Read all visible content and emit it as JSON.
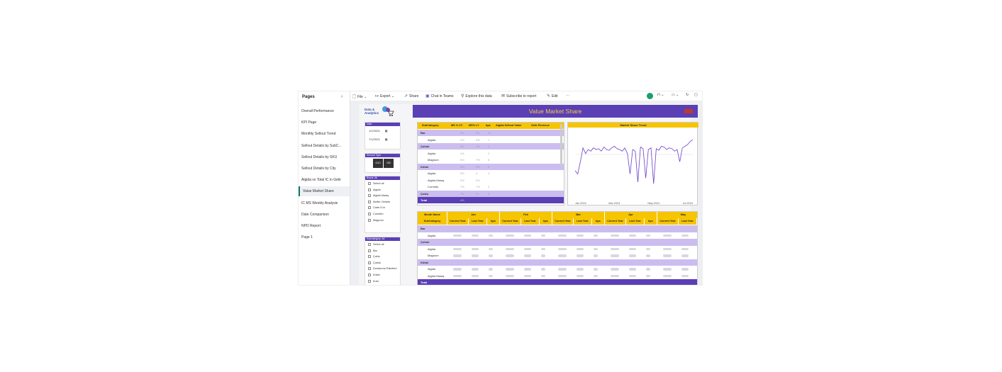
{
  "sidebar": {
    "title": "Pages",
    "collapse_icon": "chevron-left-icon",
    "items": [
      {
        "label": "Overall Performance"
      },
      {
        "label": "KPI Page"
      },
      {
        "label": "Monthly Sellout Trend"
      },
      {
        "label": "Sellout Details by SubC..."
      },
      {
        "label": "Sellout Details by SKU"
      },
      {
        "label": "Sellout Details by City"
      },
      {
        "label": "Algida vs Total IC in Getir"
      },
      {
        "label": "Value Market Share",
        "active": true
      },
      {
        "label": "IC MS Weekly Analysis"
      },
      {
        "label": "Date Comparison"
      },
      {
        "label": "NPD Report"
      },
      {
        "label": "Page 1"
      }
    ]
  },
  "toolbar": {
    "file": "File",
    "export": "Export",
    "share": "Share",
    "chat": "Chat in Teams",
    "explore": "Explore this data",
    "subscribe": "Subscribe to report",
    "edit": "Edit",
    "more": "···"
  },
  "report": {
    "title": "Value Market Share",
    "logo_text_1": "Data &",
    "logo_text_2": "Analytics",
    "accent": "#5b3fb5",
    "header_yellow": "#f6c500"
  },
  "date_slicer": {
    "header": "Date",
    "start": "1/1/2024",
    "end": "7/1/2024"
  },
  "service_slicer": {
    "header": "Service Type",
    "options": [
      "G10",
      "GB"
    ]
  },
  "brand_slicer": {
    "header": "Brand: All",
    "items": [
      "Select all",
      "Algida",
      "Algida Maraş",
      "Atelier Gelarto",
      "Carte D'or",
      "Cornetto",
      "Magnum"
    ]
  },
  "subcat_slicer": {
    "header": "Subcategory: All",
    "items": [
      "Select all",
      "Bar",
      "Çoklu",
      "Çubuk",
      "Dondurma Paketleri",
      "Külah",
      "Kutu"
    ]
  },
  "top_table": {
    "headers": [
      "SubCategory",
      "MS % CY",
      "MS% LY",
      "bps",
      "Algida Sellout Value",
      "Getir Revenue"
    ],
    "rows": [
      {
        "type": "cat",
        "name": "Bar",
        "c1": "3%",
        "c2": "8%",
        "c3": "11"
      },
      {
        "type": "sub",
        "name": "Algida",
        "c1": "3%",
        "c2": "5%",
        "c3": "1"
      },
      {
        "type": "cat",
        "name": "Çubuk",
        "c1": "8%",
        "c2": "1%",
        "c3": "1"
      },
      {
        "type": "sub",
        "name": "Algida",
        "c1": "4%",
        "c2": "",
        "c3": "2"
      },
      {
        "type": "sub",
        "name": "Magnum",
        "c1": "6%",
        "c2": "7%",
        "c3": "8"
      },
      {
        "type": "cat",
        "name": "Külah",
        "c1": "3%",
        "c2": "8%",
        "c3": "8"
      },
      {
        "type": "sub",
        "name": "Algida",
        "c1": "3%",
        "c2": "4",
        "c3": "4"
      },
      {
        "type": "sub",
        "name": "Algida Maraş",
        "c1": "0%",
        "c2": "5%",
        "c3": ""
      },
      {
        "type": "sub",
        "name": "Cornetto",
        "c1": "7%",
        "c2": "7%",
        "c3": "2"
      },
      {
        "type": "cat",
        "name": "Çoklu",
        "c1": "7%",
        "c2": "%",
        "c3": "4"
      },
      {
        "type": "total",
        "name": "Total",
        "c1": "4%",
        "c2": "",
        "c3": ""
      }
    ]
  },
  "chart_data": {
    "type": "line",
    "title": "Market Share Trend",
    "x_ticks": [
      "Jan 2024",
      "Mar 2024",
      "May 2024",
      "Jul 2024"
    ],
    "series": [
      {
        "values": [
          34,
          30,
          45,
          62,
          55,
          60,
          58,
          62,
          60,
          61,
          58,
          63,
          60,
          59,
          62,
          64,
          61,
          60,
          58,
          62,
          55,
          30,
          60,
          58,
          20,
          63,
          61,
          25,
          60,
          62,
          18,
          61,
          59,
          64,
          63,
          60,
          62,
          61,
          58,
          60,
          45,
          62,
          64,
          66,
          70,
          72
        ]
      }
    ],
    "color": "#6a3fc8"
  },
  "bottom_table": {
    "month_header": "Month Name",
    "sub_header": "SubCategory",
    "months": [
      "Jan",
      "Feb",
      "Mar",
      "Apr",
      "May"
    ],
    "cols": [
      "Current Year",
      "Last Year",
      "bps"
    ],
    "rows": [
      {
        "type": "cat",
        "name": "Bar"
      },
      {
        "type": "sub",
        "name": "Algida"
      },
      {
        "type": "cat",
        "name": "Çubuk"
      },
      {
        "type": "sub",
        "name": "Algida"
      },
      {
        "type": "sub",
        "name": "Magnum"
      },
      {
        "type": "cat",
        "name": "Külah"
      },
      {
        "type": "sub",
        "name": "Algida"
      },
      {
        "type": "sub",
        "name": "Algida Maraş"
      },
      {
        "type": "total",
        "name": "Total"
      }
    ]
  }
}
